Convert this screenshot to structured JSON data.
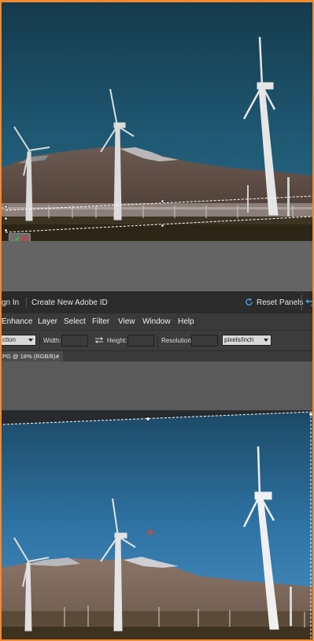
{
  "app_bar": {
    "sign_in": "gn In",
    "create_id": "Create New Adobe ID",
    "reset_panels": "Reset Panels"
  },
  "menu": {
    "items": [
      "Enhance",
      "Layer",
      "Select",
      "Filter",
      "View",
      "Window",
      "Help"
    ]
  },
  "options_bar": {
    "preset": "ction",
    "width_label": "Width:",
    "height_label": "Height:",
    "resolution_label": "Resolution:",
    "resolution_unit": "pixels/inch"
  },
  "document_tab": {
    "title": "PG @ 18% (RGB/8) *",
    "close": "×"
  },
  "icons": {
    "reset": "reset-circular-arrow-icon",
    "swap": "swap-arrows-icon",
    "commit": "checkmark-icon",
    "cancel": "cancel-icon",
    "center": "crosshair-icon"
  },
  "colors": {
    "accent_orange": "#f28a2e",
    "reset_blue": "#3fa0e6",
    "commit_green": "#3cb84a",
    "cancel_red": "#d83a3a"
  }
}
